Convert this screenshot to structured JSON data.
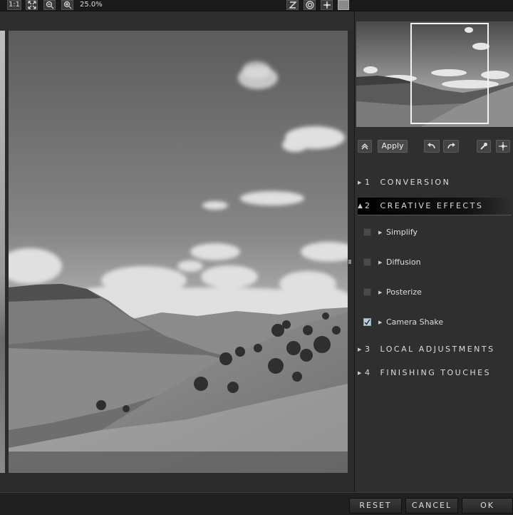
{
  "toolbar": {
    "actual_size_label": "1:1",
    "zoom_level": "25.0%",
    "icons": [
      "fit-icon",
      "zoom-out-icon",
      "zoom-in-icon",
      "z-tool-icon",
      "target-icon",
      "move-icon"
    ]
  },
  "panel": {
    "apply_label": "Apply",
    "sections": [
      {
        "number": "1",
        "title": "CONVERSION",
        "expanded": false
      },
      {
        "number": "2",
        "title": "CREATIVE EFFECTS",
        "expanded": true
      },
      {
        "number": "3",
        "title": "LOCAL ADJUSTMENTS",
        "expanded": false
      },
      {
        "number": "4",
        "title": "FINISHING TOUCHES",
        "expanded": false
      }
    ],
    "effects": [
      {
        "label": "Simplify",
        "checked": false
      },
      {
        "label": "Diffusion",
        "checked": false
      },
      {
        "label": "Posterize",
        "checked": false
      },
      {
        "label": "Camera Shake",
        "checked": true
      }
    ]
  },
  "footer": {
    "reset_label": "RESET",
    "cancel_label": "CANCEL",
    "ok_label": "OK"
  },
  "colors": {
    "background": "#2a2a2a",
    "panel": "#2f2f2f",
    "toolbar": "#1a1a1a",
    "text": "#d8d8d8",
    "nav_frame": "#f2f2f2"
  }
}
